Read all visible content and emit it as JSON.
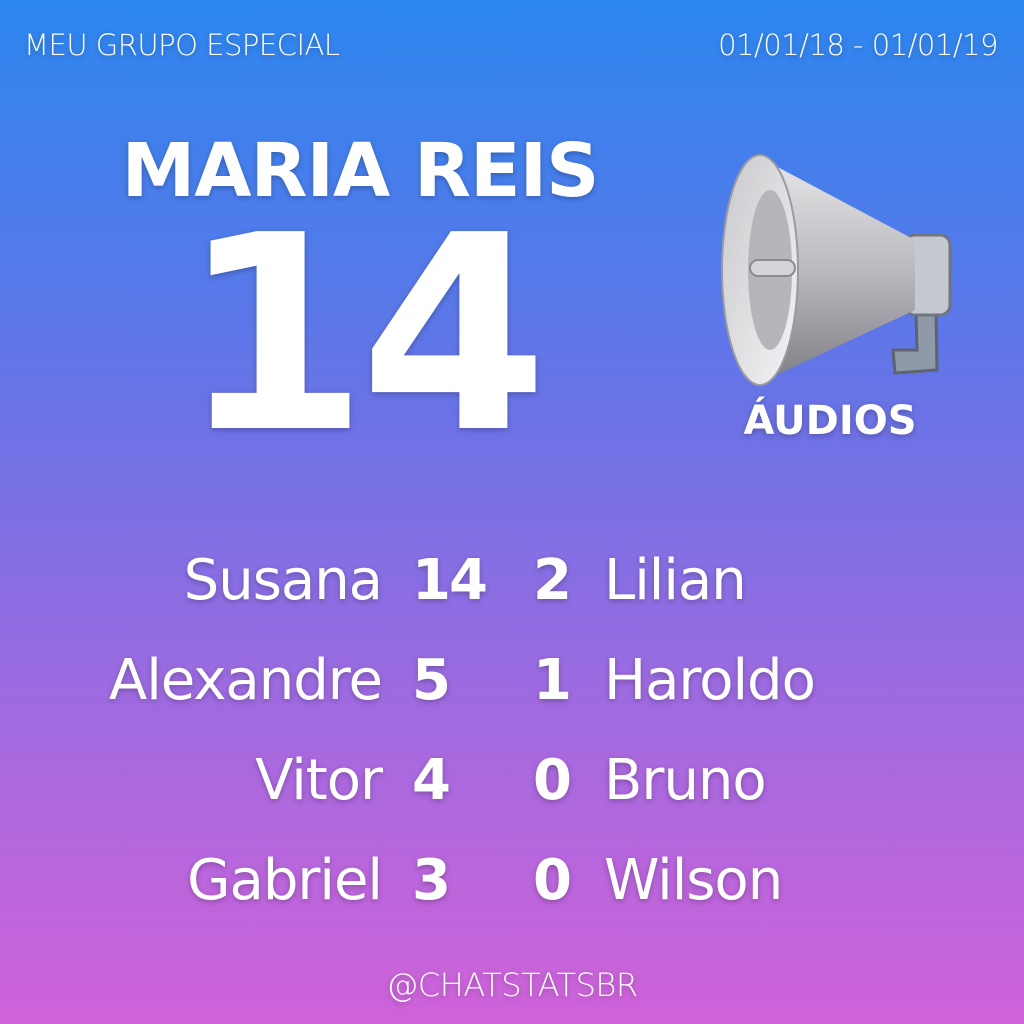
{
  "header": {
    "group_name": "MEU GRUPO ESPECIAL",
    "date_range": "01/01/18 - 01/01/19"
  },
  "highlight": {
    "name": "MARIA REIS",
    "count": "14",
    "category": "ÁUDIOS",
    "icon": "megaphone-icon"
  },
  "ranking": {
    "left": [
      {
        "name": "Susana",
        "count": "14"
      },
      {
        "name": "Alexandre",
        "count": "5"
      },
      {
        "name": "Vitor",
        "count": "4"
      },
      {
        "name": "Gabriel",
        "count": "3"
      }
    ],
    "right": [
      {
        "name": "Lilian",
        "count": "2"
      },
      {
        "name": "Haroldo",
        "count": "1"
      },
      {
        "name": "Bruno",
        "count": "0"
      },
      {
        "name": "Wilson",
        "count": "0"
      }
    ]
  },
  "footer": {
    "handle": "@CHATSTATSBR"
  },
  "colors": {
    "gradient_top": "#2c86ef",
    "gradient_bottom": "#d062d9",
    "text": "#ffffff"
  }
}
